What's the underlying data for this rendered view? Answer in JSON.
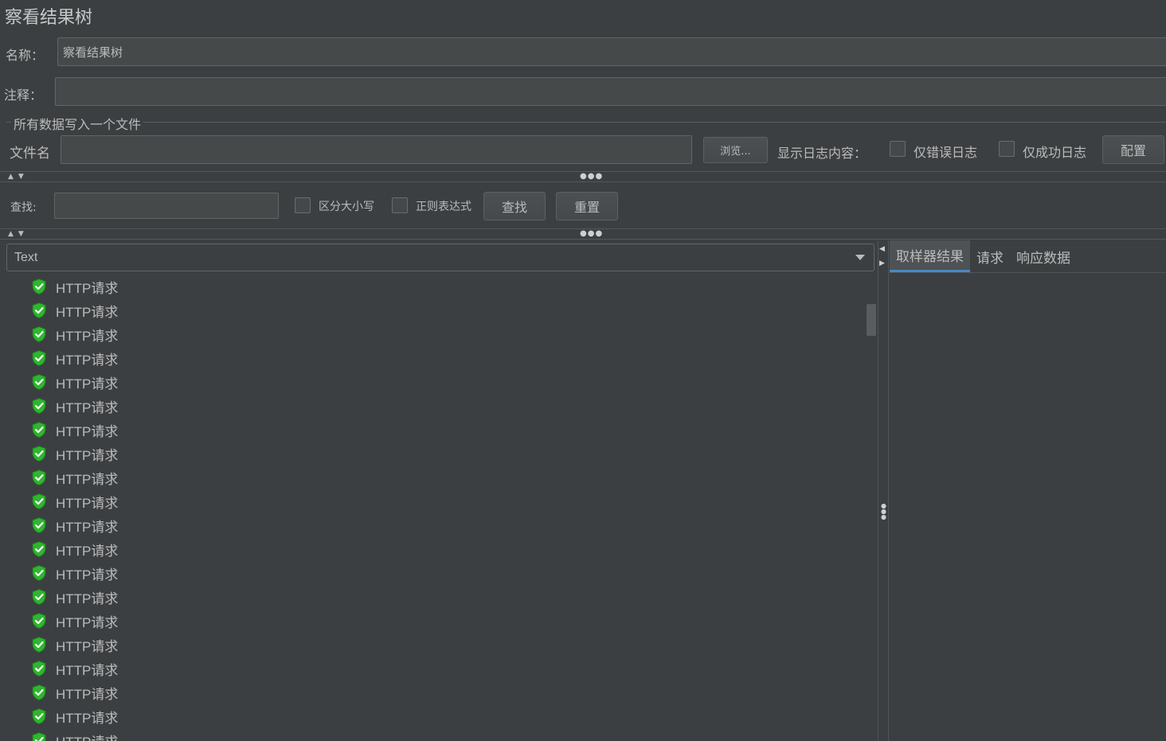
{
  "window": {
    "title": "察看结果树"
  },
  "name_field": {
    "label": "名称：",
    "value": "察看结果树"
  },
  "comment_field": {
    "label": "注释：",
    "value": ""
  },
  "file_group": {
    "title": "所有数据写入一个文件",
    "filename_label": "文件名",
    "filename_value": "",
    "browse_label": "浏览...",
    "log_display_label": "显示日志内容：",
    "errors_only_label": "仅错误日志",
    "success_only_label": "仅成功日志",
    "configure_label": "配置"
  },
  "search": {
    "label": "查找:",
    "value": "",
    "case_sensitive_label": "区分大小写",
    "regex_label": "正则表达式",
    "find_label": "查找",
    "reset_label": "重置"
  },
  "renderer": {
    "selected": "Text"
  },
  "tree": {
    "items": [
      "HTTP请求",
      "HTTP请求",
      "HTTP请求",
      "HTTP请求",
      "HTTP请求",
      "HTTP请求",
      "HTTP请求",
      "HTTP请求",
      "HTTP请求",
      "HTTP请求",
      "HTTP请求",
      "HTTP请求",
      "HTTP请求",
      "HTTP请求",
      "HTTP请求",
      "HTTP请求",
      "HTTP请求",
      "HTTP请求",
      "HTTP请求",
      "HTTP请求"
    ],
    "item_icon": "green-shield-check-icon"
  },
  "result_tabs": [
    {
      "label": "取样器结果",
      "active": true
    },
    {
      "label": "请求",
      "active": false
    },
    {
      "label": "响应数据",
      "active": false
    }
  ],
  "colors": {
    "background": "#3c3f41",
    "text": "#bbbbbb",
    "success_icon": "#2fb52f",
    "tab_accent": "#4a88c7"
  }
}
